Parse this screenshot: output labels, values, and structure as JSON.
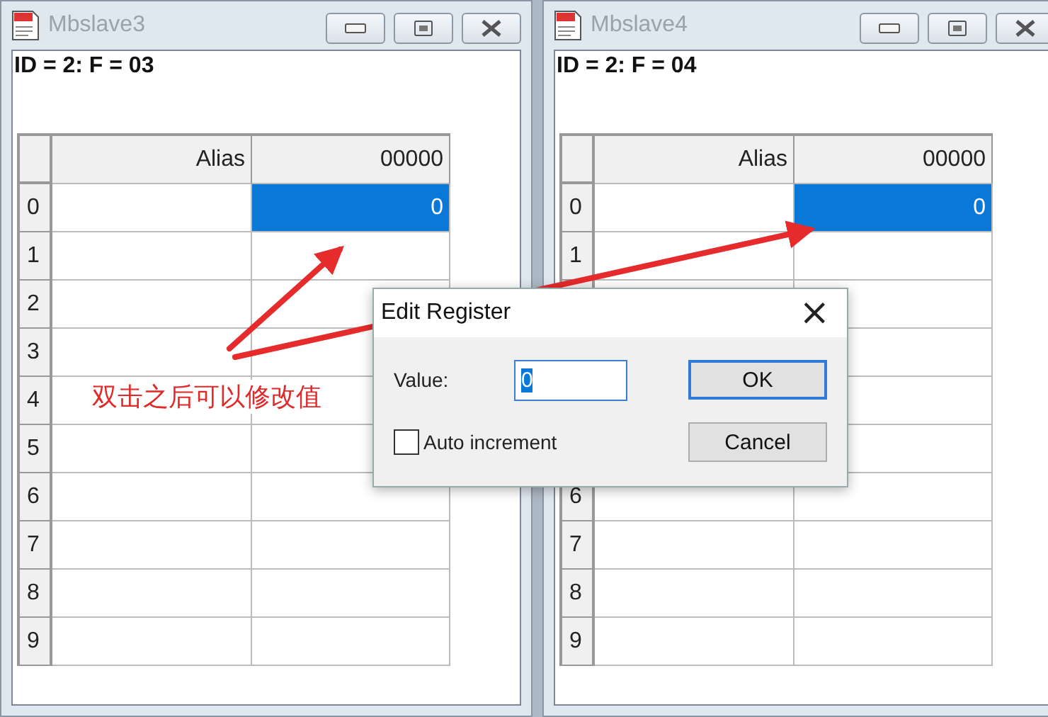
{
  "windows": [
    {
      "title": "Mbslave3",
      "info": "ID = 2: F = 03",
      "columns": [
        "Alias",
        "00000"
      ],
      "rows": [
        {
          "label": "0",
          "value": "0",
          "selected": true
        },
        {
          "label": "1",
          "selected": false
        },
        {
          "label": "2",
          "selected": false
        },
        {
          "label": "3",
          "selected": false
        },
        {
          "label": "4",
          "selected": false
        },
        {
          "label": "5",
          "selected": false
        },
        {
          "label": "6",
          "selected": false
        },
        {
          "label": "7",
          "selected": false
        },
        {
          "label": "8",
          "selected": false
        },
        {
          "label": "9",
          "selected": false
        }
      ]
    },
    {
      "title": "Mbslave4",
      "info": "ID = 2: F = 04",
      "columns": [
        "Alias",
        "00000"
      ],
      "rows": [
        {
          "label": "0",
          "value": "0",
          "selected": true
        },
        {
          "label": "1",
          "selected": false
        },
        {
          "selected": false
        },
        {
          "selected": false
        },
        {
          "selected": false
        },
        {
          "selected": false
        },
        {
          "label": "6",
          "selected": false
        },
        {
          "label": "7",
          "selected": false
        },
        {
          "label": "8",
          "selected": false
        },
        {
          "label": "9",
          "selected": false
        }
      ]
    }
  ],
  "dialog": {
    "title": "Edit Register",
    "close": "×",
    "value_label": "Value:",
    "value": "0",
    "checkbox": {
      "label": "Auto increment",
      "checked": false
    },
    "buttons": [
      {
        "label": "OK",
        "default": true
      },
      {
        "label": "Cancel",
        "default": false
      }
    ]
  },
  "annotation": {
    "text": "双击之后可以修改值"
  }
}
